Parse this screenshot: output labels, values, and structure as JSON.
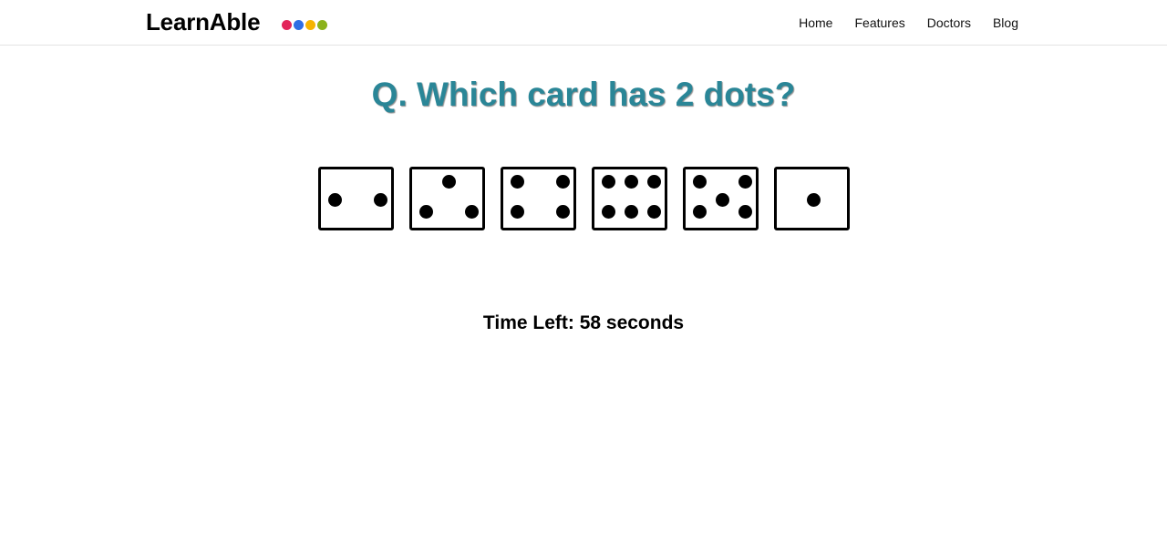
{
  "header": {
    "brand": "LearnAble",
    "brand_dot_colors": [
      "#e2245a",
      "#2f6fe4",
      "#f6b400",
      "#8bb21b"
    ],
    "nav": [
      {
        "label": "Home"
      },
      {
        "label": "Features"
      },
      {
        "label": "Doctors"
      },
      {
        "label": "Blog"
      }
    ]
  },
  "quiz": {
    "question": "Q. Which card has 2 dots?",
    "question_color": "#2a8697",
    "cards": [
      {
        "dots": 2
      },
      {
        "dots": 3
      },
      {
        "dots": 4
      },
      {
        "dots": 6
      },
      {
        "dots": 5
      },
      {
        "dots": 1
      }
    ],
    "timer_text": "Time Left: 58 seconds"
  }
}
